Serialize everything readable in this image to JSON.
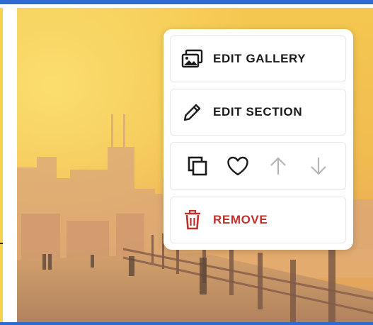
{
  "menu": {
    "edit_gallery": {
      "label": "EDIT GALLERY",
      "icon": "gallery-icon"
    },
    "edit_section": {
      "label": "EDIT SECTION",
      "icon": "pencil-icon"
    },
    "actions": [
      {
        "icon": "duplicate-icon",
        "enabled": true
      },
      {
        "icon": "heart-icon",
        "enabled": true
      },
      {
        "icon": "arrow-up-icon",
        "enabled": false
      },
      {
        "icon": "arrow-down-icon",
        "enabled": false
      }
    ],
    "remove": {
      "label": "REMOVE",
      "icon": "trash-icon"
    }
  },
  "colors": {
    "accent_blue": "#2d6bcf",
    "remove_red": "#c0302b",
    "disabled_gray": "#b5b5b5",
    "text_dark": "#1b1b1b"
  },
  "photo": {
    "subject": "city-skyline-waterfront-photo"
  }
}
